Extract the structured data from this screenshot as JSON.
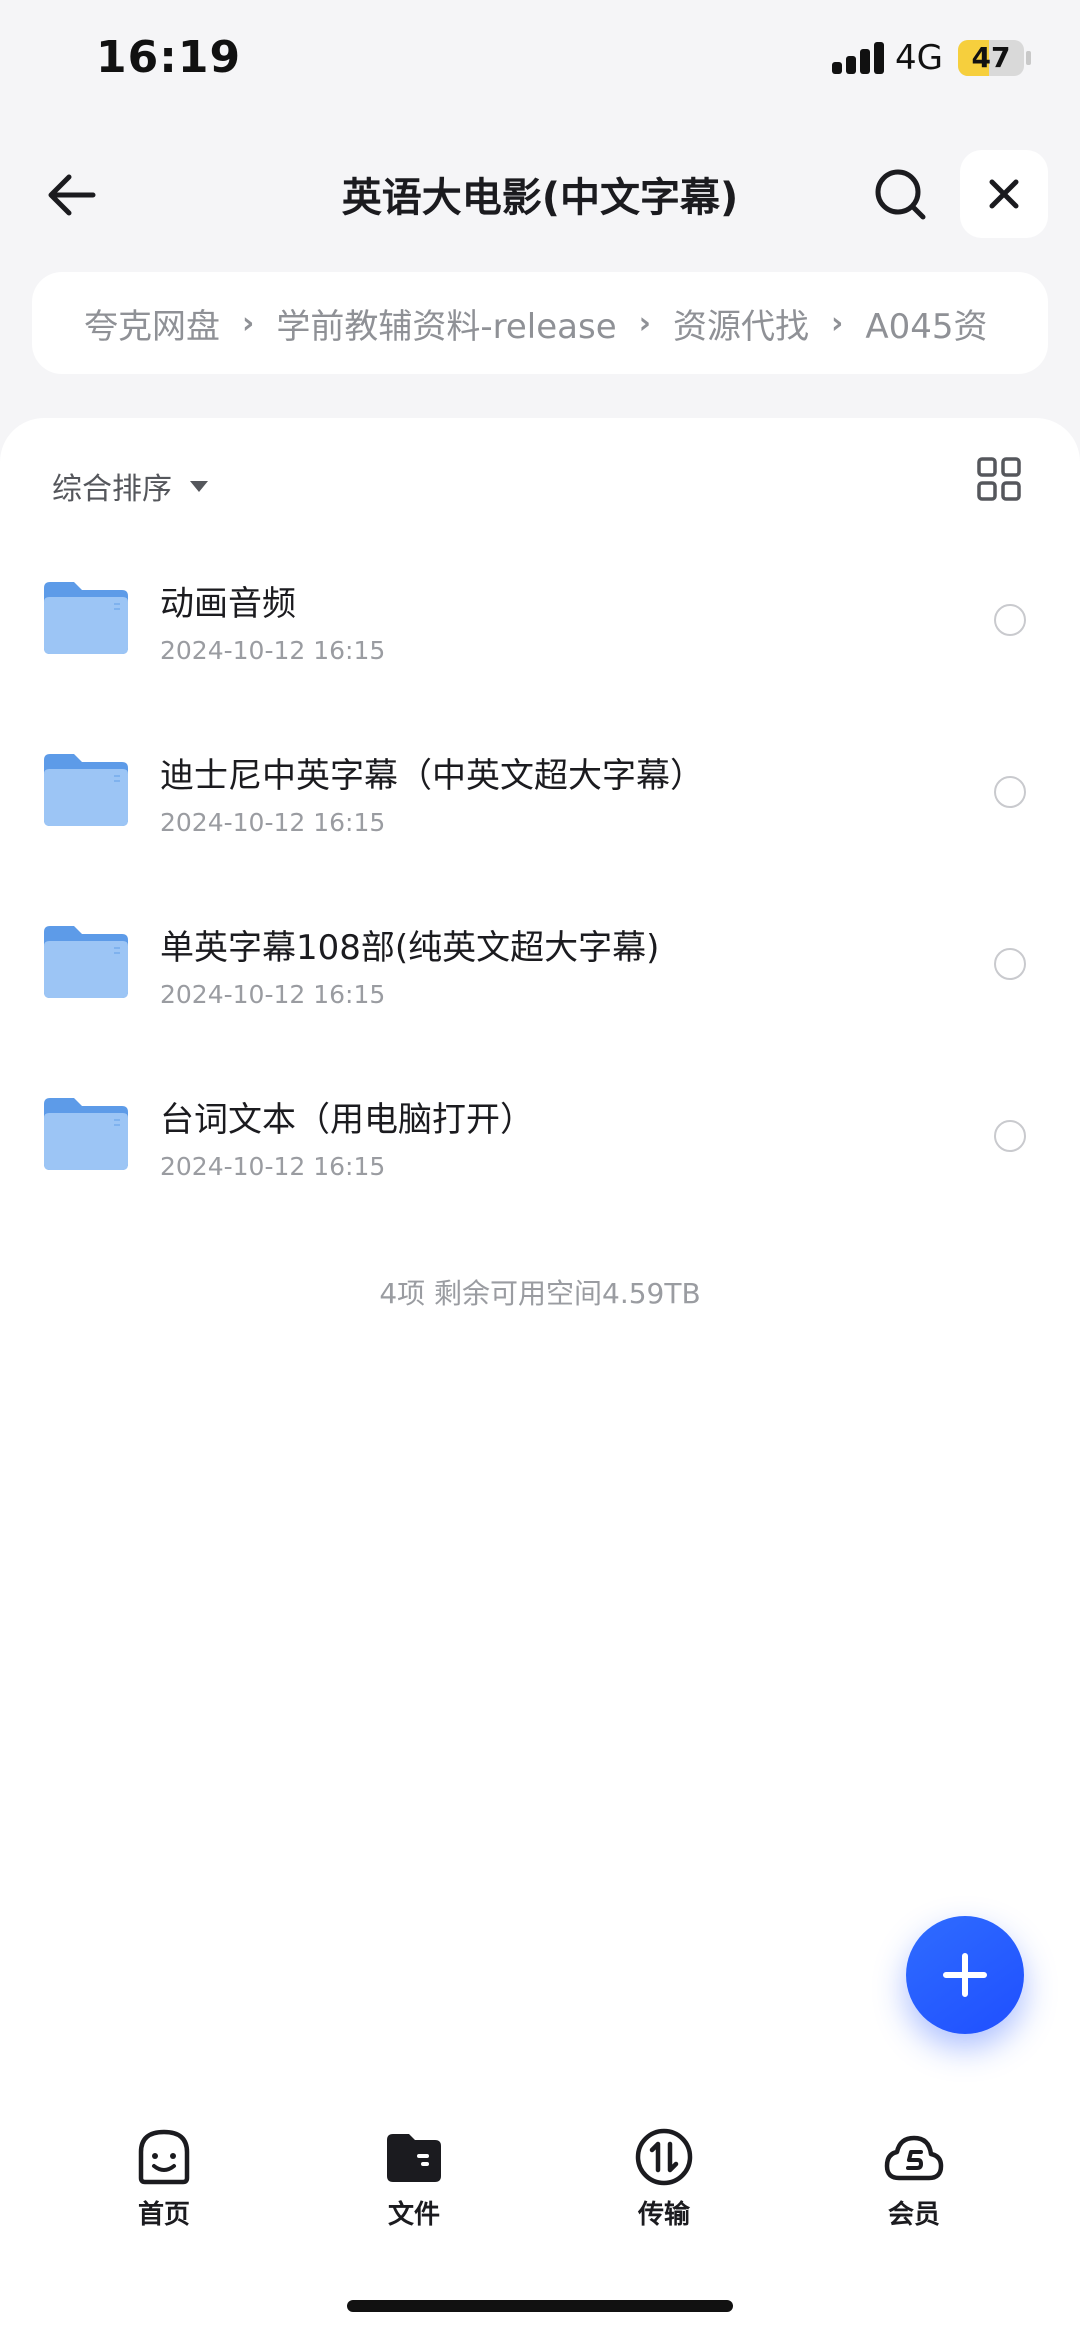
{
  "status_bar": {
    "time": "16:19",
    "network": "4G",
    "battery_level": "47",
    "battery_fraction": 0.47,
    "battery_color": "#f6cf3d"
  },
  "header": {
    "title": "英语大电影(中文字幕)",
    "back_icon": "arrow-left-icon",
    "search_icon": "search-icon",
    "close_icon": "close-icon"
  },
  "breadcrumb": {
    "items": [
      "夸克网盘",
      "学前教辅资料-release",
      "资源代找",
      "A045资"
    ],
    "separator": "›"
  },
  "toolbar": {
    "sort_label": "综合排序",
    "grid_icon": "grid-view-icon"
  },
  "files": [
    {
      "name": "动画音频",
      "date": "2024-10-12 16:15",
      "icon": "folder-icon"
    },
    {
      "name": "迪士尼中英字幕（中英文超大字幕）",
      "date": "2024-10-12 16:15",
      "icon": "folder-icon"
    },
    {
      "name": "单英字幕108部(纯英文超大字幕)",
      "date": "2024-10-12 16:15",
      "icon": "folder-icon"
    },
    {
      "name": "台词文本（用电脑打开）",
      "date": "2024-10-12 16:15",
      "icon": "folder-icon"
    }
  ],
  "summary": "4项 剩余可用空间4.59TB",
  "fab": {
    "icon": "plus-icon",
    "color": "#2a5cff"
  },
  "tabs": [
    {
      "label": "首页",
      "icon": "smile-face-icon"
    },
    {
      "label": "文件",
      "icon": "folder-filled-icon"
    },
    {
      "label": "传输",
      "icon": "transfer-icon"
    },
    {
      "label": "会员",
      "icon": "cloud-vip-icon"
    }
  ],
  "colors": {
    "accent": "#2a5cff",
    "folder": "#6fa8ef",
    "text_primary": "#1b1b1f",
    "text_secondary": "#9a9ca1"
  }
}
